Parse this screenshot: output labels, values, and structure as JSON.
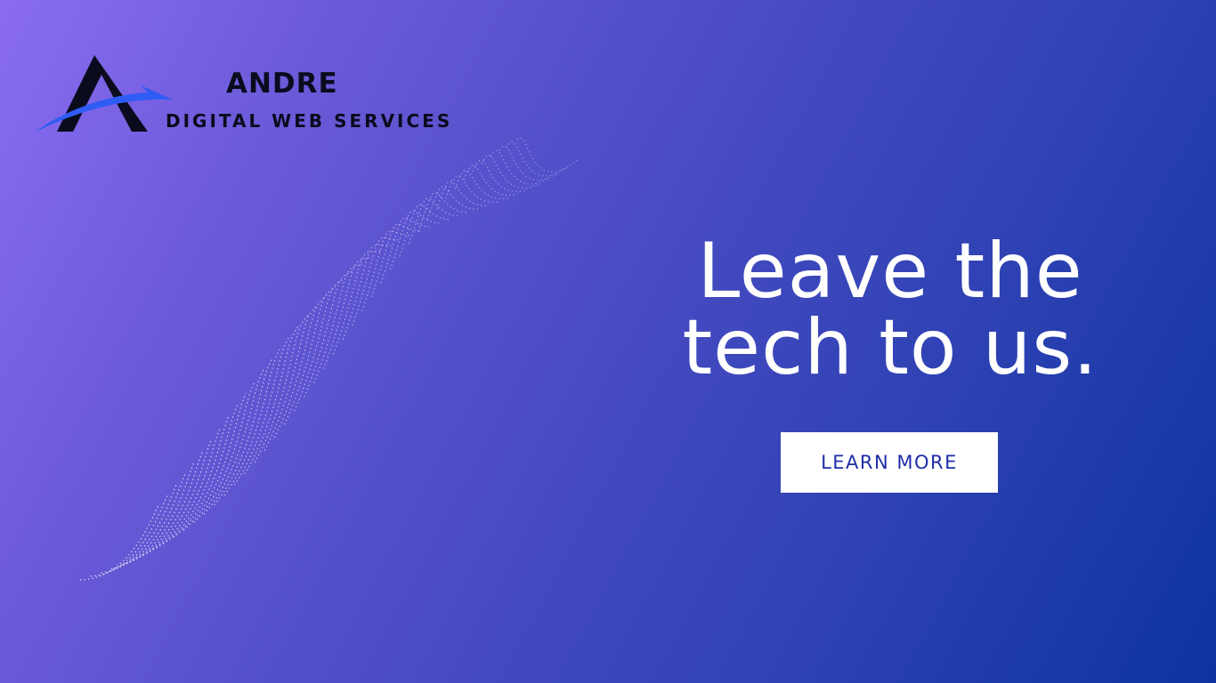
{
  "brand": {
    "logo_icon": "stylized-letter-a-swoosh-logo",
    "name": "ANDRE",
    "tagline": "DIGITAL WEB SERVICES"
  },
  "decoration": {
    "icon": "dotted-wave-mesh-graphic"
  },
  "hero": {
    "headline_line1": "Leave the",
    "headline_line2": "tech to us.",
    "cta_label": "LEARN MORE"
  },
  "colors": {
    "gradient_start": "#8a6cf0",
    "gradient_end": "#0d33a0",
    "logo_dark": "#0b0b1e",
    "logo_accent": "#2f5cf5",
    "cta_background": "#ffffff",
    "cta_text": "#1f2ea8",
    "headline": "#ffffff"
  }
}
